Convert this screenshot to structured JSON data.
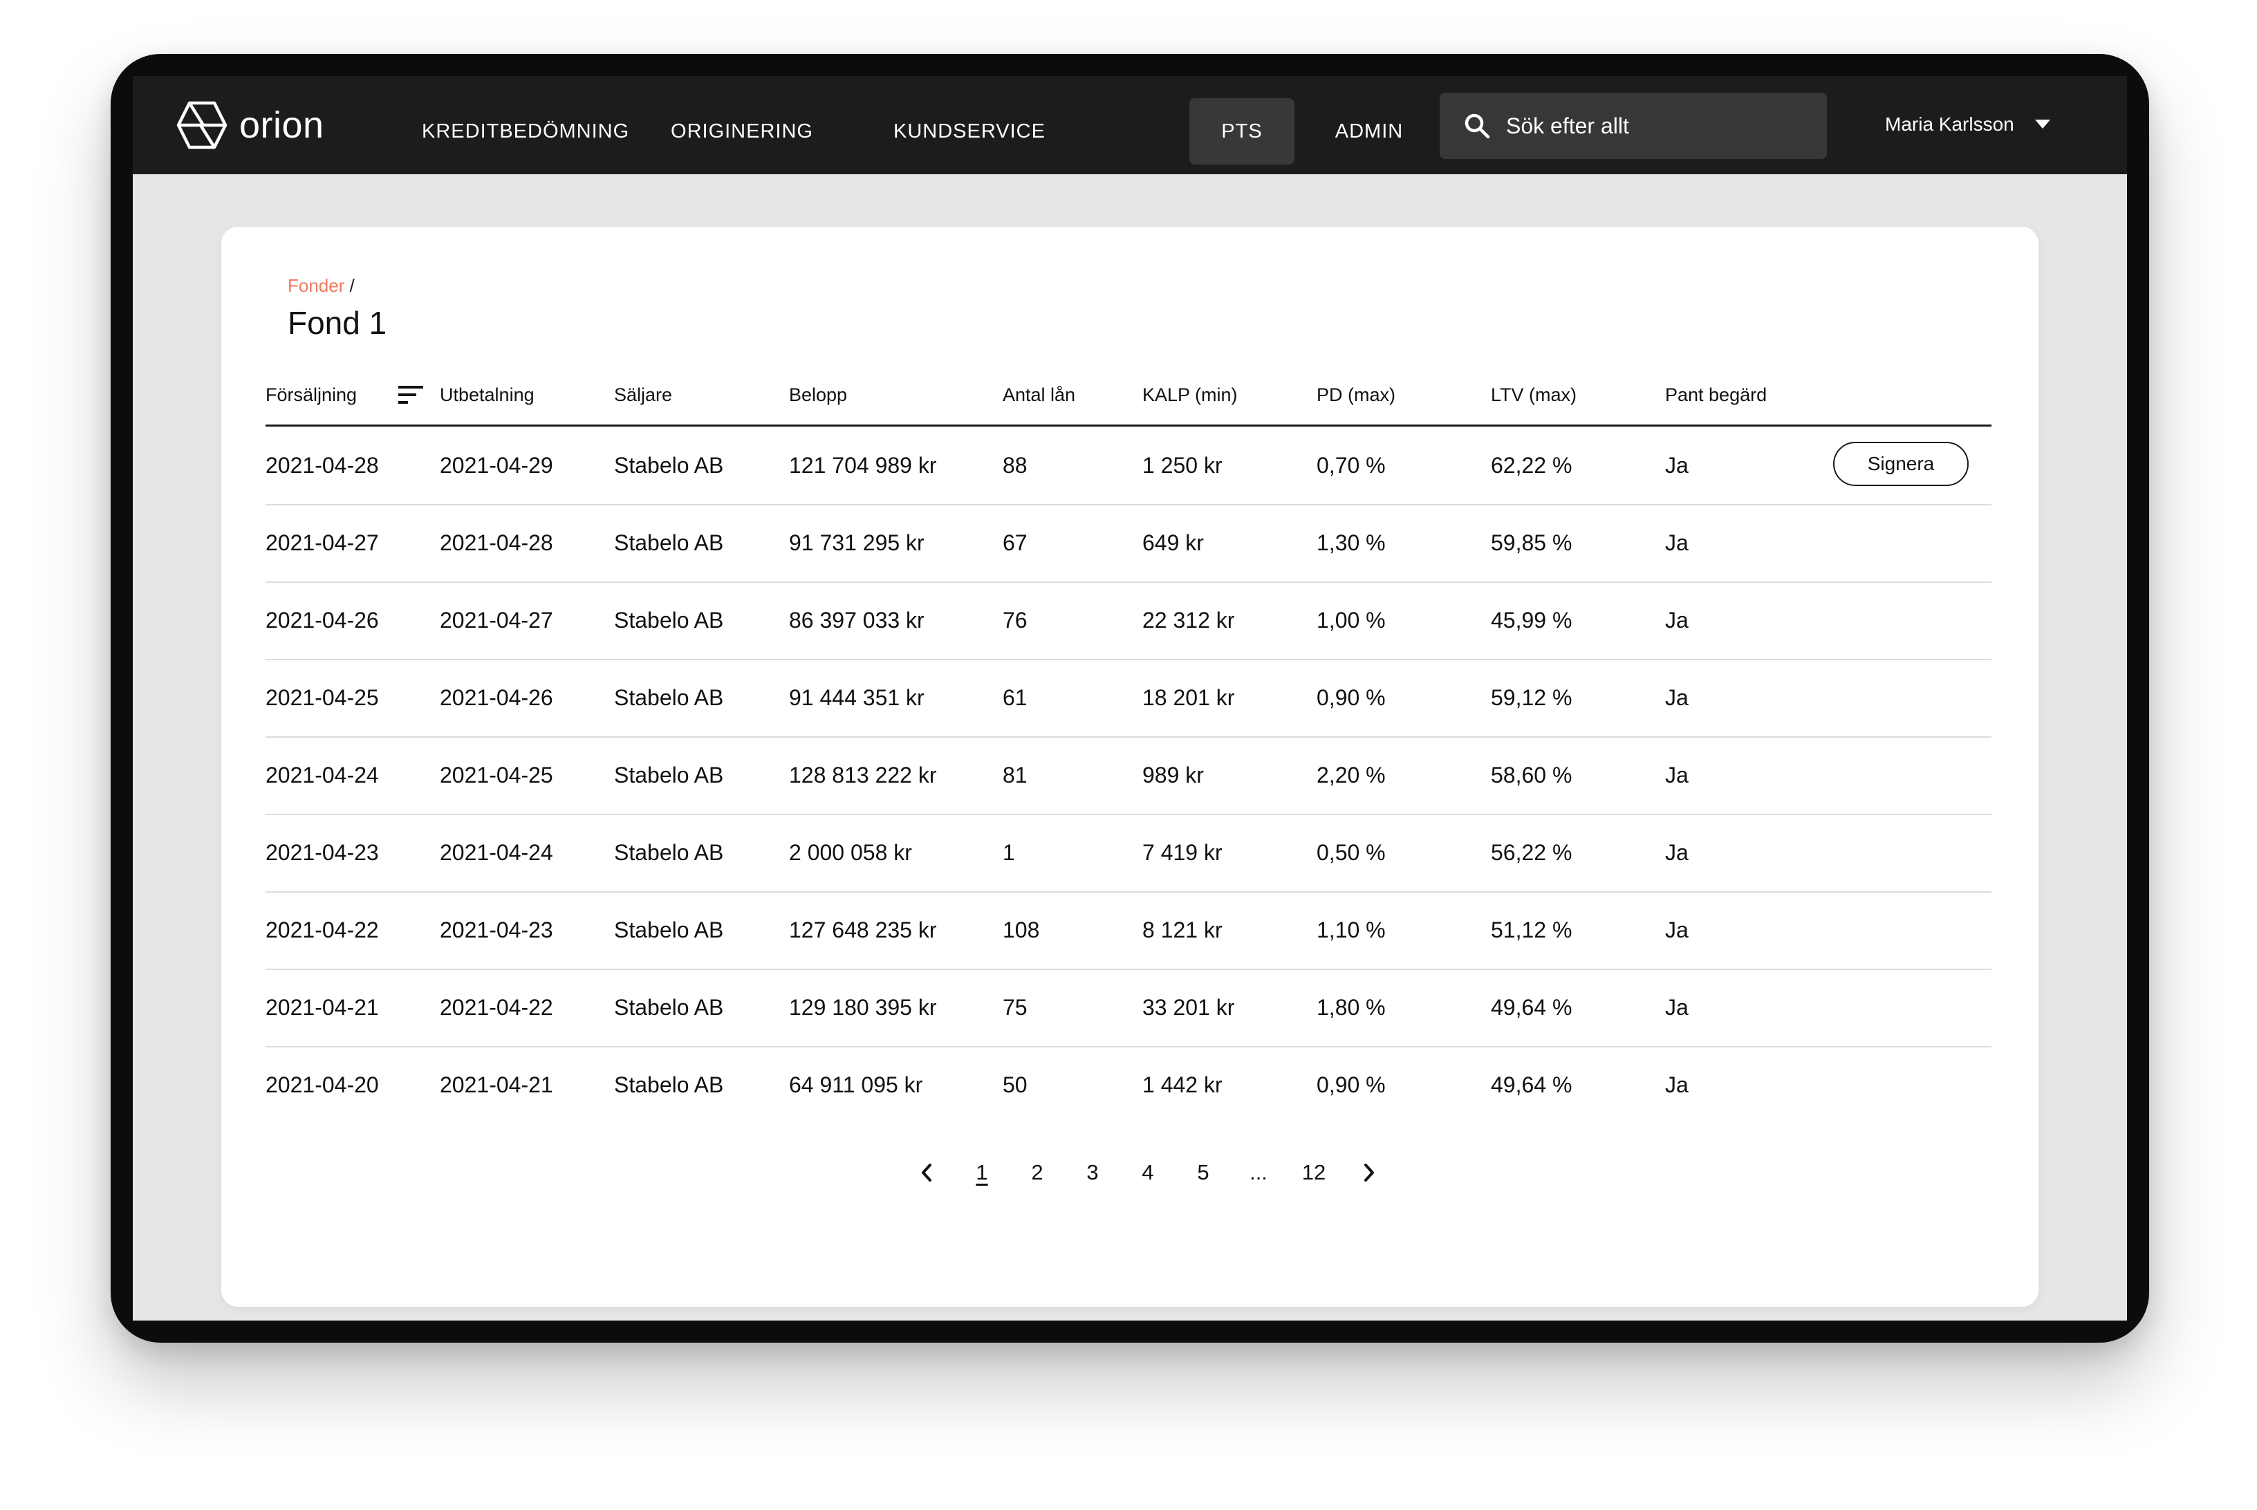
{
  "brand": {
    "name": "orion"
  },
  "nav": {
    "items": [
      {
        "label": "KREDITBEDÖMNING",
        "active": false
      },
      {
        "label": "ORIGINERING",
        "active": false
      },
      {
        "label": "KUNDSERVICE",
        "active": false
      },
      {
        "label": "PTS",
        "active": true
      },
      {
        "label": "ADMIN",
        "active": false
      }
    ]
  },
  "search": {
    "placeholder": "Sök efter allt",
    "icon": "search-icon"
  },
  "user": {
    "name": "Maria Karlsson",
    "icon": "caret-down-icon"
  },
  "breadcrumb": {
    "parent": "Fonder",
    "separator": "/"
  },
  "page": {
    "title": "Fond 1"
  },
  "table": {
    "columns": [
      "Försäljning",
      "Utbetalning",
      "Säljare",
      "Belopp",
      "Antal lån",
      "KALP (min)",
      "PD (max)",
      "LTV (max)",
      "Pant begärd"
    ],
    "action_label": "Signera",
    "rows": [
      [
        "2021-04-28",
        "2021-04-29",
        "Stabelo AB",
        "121 704 989 kr",
        "88",
        "1 250 kr",
        "0,70 %",
        "62,22 %",
        "Ja"
      ],
      [
        "2021-04-27",
        "2021-04-28",
        "Stabelo AB",
        "91 731 295 kr",
        "67",
        "649 kr",
        "1,30 %",
        "59,85 %",
        "Ja"
      ],
      [
        "2021-04-26",
        "2021-04-27",
        "Stabelo AB",
        "86 397 033 kr",
        "76",
        "22 312 kr",
        "1,00 %",
        "45,99 %",
        "Ja"
      ],
      [
        "2021-04-25",
        "2021-04-26",
        "Stabelo AB",
        "91 444 351 kr",
        "61",
        "18 201 kr",
        "0,90 %",
        "59,12 %",
        "Ja"
      ],
      [
        "2021-04-24",
        "2021-04-25",
        "Stabelo AB",
        "128 813 222 kr",
        "81",
        "989 kr",
        "2,20 %",
        "58,60 %",
        "Ja"
      ],
      [
        "2021-04-23",
        "2021-04-24",
        "Stabelo AB",
        "2 000 058 kr",
        "1",
        "7 419 kr",
        "0,50 %",
        "56,22 %",
        "Ja"
      ],
      [
        "2021-04-22",
        "2021-04-23",
        "Stabelo AB",
        "127 648 235 kr",
        "108",
        "8 121 kr",
        "1,10 %",
        "51,12 %",
        "Ja"
      ],
      [
        "2021-04-21",
        "2021-04-22",
        "Stabelo AB",
        "129 180 395 kr",
        "75",
        "33 201 kr",
        "1,80 %",
        "49,64 %",
        "Ja"
      ],
      [
        "2021-04-20",
        "2021-04-21",
        "Stabelo AB",
        "64 911 095 kr",
        "50",
        "1 442 kr",
        "0,90 %",
        "49,64 %",
        "Ja"
      ]
    ]
  },
  "pagination": {
    "pages": [
      "1",
      "2",
      "3",
      "4",
      "5",
      "...",
      "12"
    ],
    "current": "1"
  },
  "colors": {
    "topbar": "#1c1c1c",
    "accent_link": "#f07a61",
    "background": "#e6e7e5"
  }
}
